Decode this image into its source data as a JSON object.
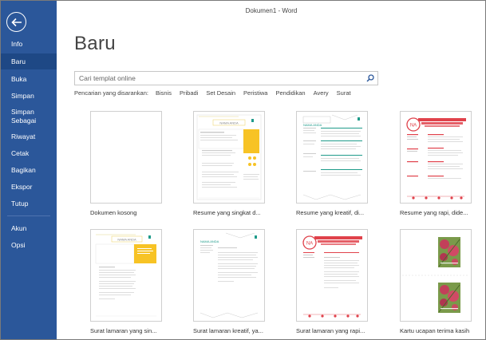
{
  "window": {
    "title": "Dokumen1 - Word"
  },
  "sidebar": {
    "items": [
      {
        "label": "Info"
      },
      {
        "label": "Baru",
        "active": true
      },
      {
        "label": "Buka"
      },
      {
        "label": "Simpan"
      },
      {
        "label": "Simpan Sebagai"
      },
      {
        "label": "Riwayat"
      },
      {
        "label": "Cetak"
      },
      {
        "label": "Bagikan"
      },
      {
        "label": "Ekspor"
      },
      {
        "label": "Tutup"
      },
      {
        "label": "Akun"
      },
      {
        "label": "Opsi"
      }
    ]
  },
  "main": {
    "heading": "Baru",
    "search": {
      "placeholder": "Cari templat online",
      "icon": "search-icon"
    },
    "suggested": {
      "label": "Pencarian yang disarankan:",
      "links": [
        "Bisnis",
        "Pribadi",
        "Set Desain",
        "Peristiwa",
        "Pendidikan",
        "Avery",
        "Surat"
      ]
    },
    "templates": [
      {
        "label": "Dokumen kosong",
        "thumb_text": ""
      },
      {
        "label": "Resume yang singkat d...",
        "thumb_text": "NAMA ANDA"
      },
      {
        "label": "Resume yang kreatif, di...",
        "thumb_text": "NAMA ANDA"
      },
      {
        "label": "Resume yang rapi, dide...",
        "thumb_text": "NA"
      },
      {
        "label": "Surat lamaran yang sin...",
        "thumb_text": "NAMA ANDA"
      },
      {
        "label": "Surat lamaran kreatif, ya...",
        "thumb_text": "NAMA ANDA"
      },
      {
        "label": "Surat lamaran yang rapi...",
        "thumb_text": "NA"
      },
      {
        "label": "Kartu ucapan terima kasih",
        "thumb_text": ""
      }
    ]
  },
  "colors": {
    "sidebar": "#2b579a",
    "sidebar_active": "#1e4885",
    "yellow_accent": "#f7c325",
    "red_accent": "#e0424b",
    "teal_accent": "#1f9b8a"
  }
}
